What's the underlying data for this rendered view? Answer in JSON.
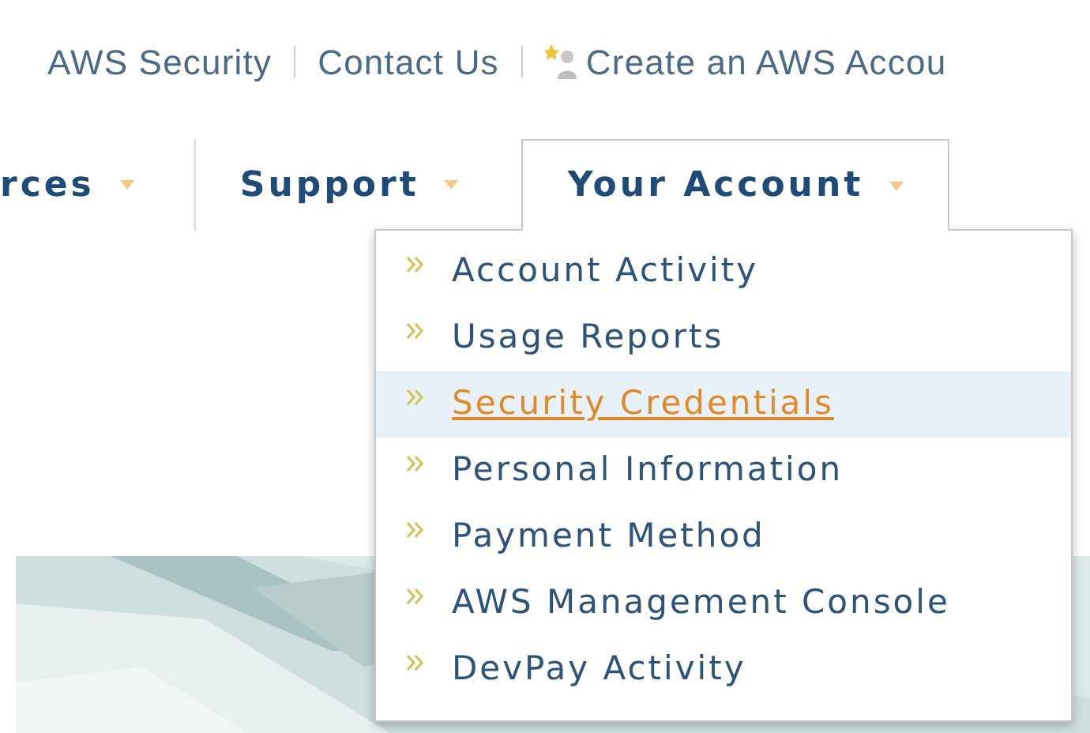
{
  "top_links": [
    {
      "label": "AWS Security",
      "kind": "text"
    },
    {
      "label": "Contact Us",
      "kind": "text"
    },
    {
      "label": "Create an AWS Accou",
      "kind": "user"
    }
  ],
  "nav_tabs": [
    {
      "label": "rces",
      "selected": false
    },
    {
      "label": "Support",
      "selected": false
    },
    {
      "label": "Your Account",
      "selected": true
    }
  ],
  "menu": {
    "items": [
      {
        "label": "Account Activity",
        "selected": false
      },
      {
        "label": "Usage Reports",
        "selected": false
      },
      {
        "label": "Security Credentials",
        "selected": true
      },
      {
        "label": "Personal Information",
        "selected": false
      },
      {
        "label": "Payment Method",
        "selected": false
      },
      {
        "label": "AWS Management Console",
        "selected": false
      },
      {
        "label": "DevPay Activity",
        "selected": false
      }
    ]
  }
}
